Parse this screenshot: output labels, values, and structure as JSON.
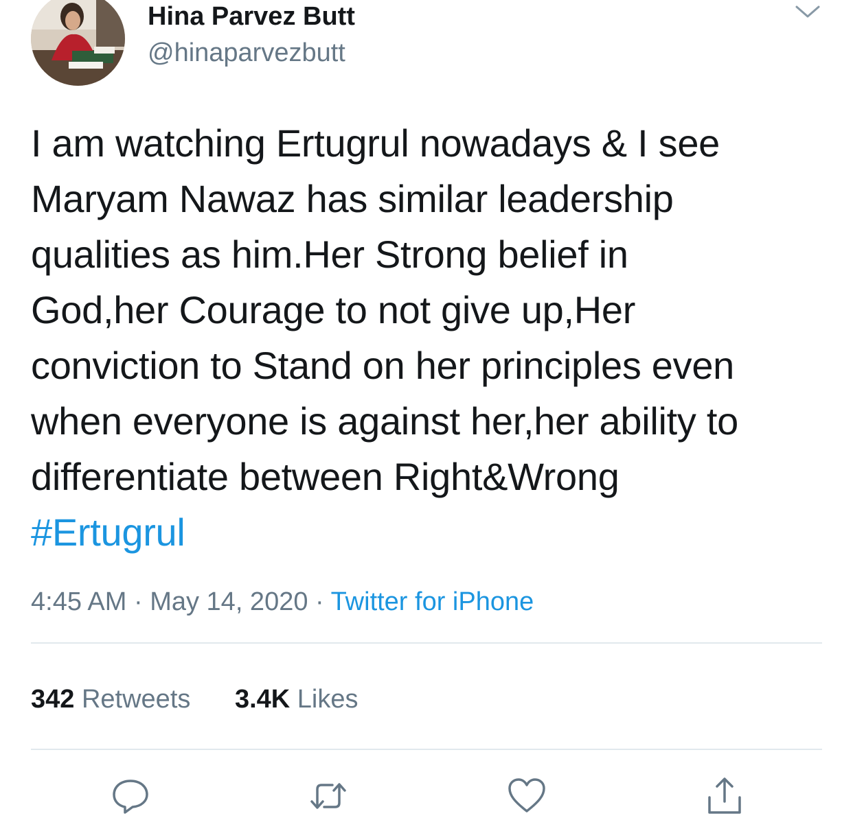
{
  "author": {
    "display_name": "Hina Parvez Butt",
    "handle": "@hinaparvezbutt"
  },
  "tweet": {
    "lines": [
      "I am watching Ertugrul nowadays & I see",
      "Maryam Nawaz has similar leadership",
      "qualities as him.Her Strong belief in",
      "God,her Courage to not give up,Her",
      "conviction to Stand on her principles even",
      "when everyone is against her,her ability to",
      "differentiate between Right&Wrong"
    ],
    "hashtag": "#Ertugrul"
  },
  "meta": {
    "time": "4:45 AM",
    "separator": "·",
    "date": "May 14, 2020",
    "source": "Twitter for iPhone"
  },
  "stats": {
    "retweets_count": "342",
    "retweets_label": "Retweets",
    "likes_count": "3.4K",
    "likes_label": "Likes"
  },
  "icons": {
    "caret": "chevron-down-icon",
    "reply": "reply-icon",
    "retweet": "retweet-icon",
    "like": "heart-icon",
    "share": "share-icon"
  },
  "colors": {
    "text": "#14171a",
    "secondary": "#657786",
    "link": "#1b95e0",
    "divider": "#e1e8ed"
  }
}
